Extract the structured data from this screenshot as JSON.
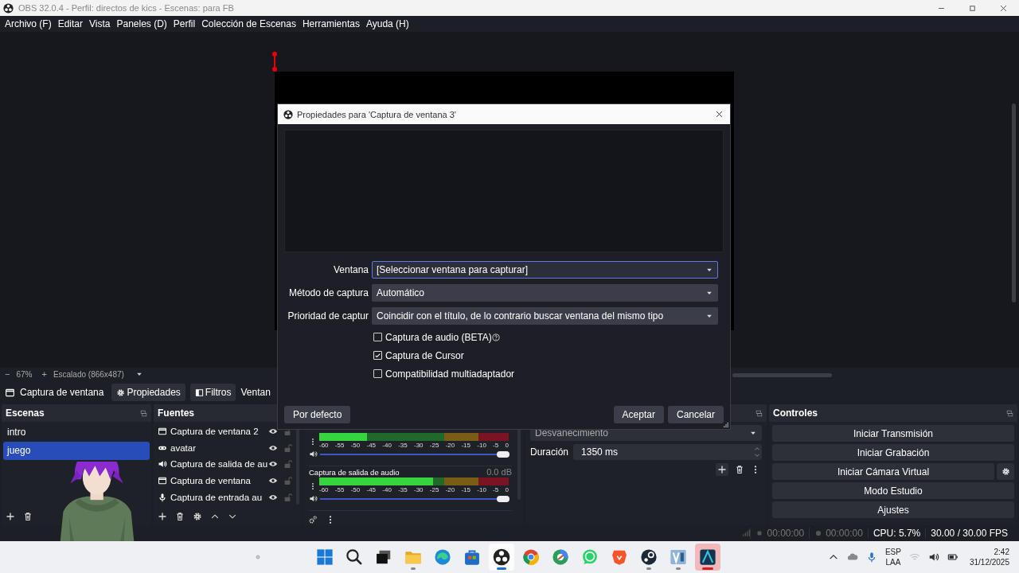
{
  "window": {
    "title": "OBS 32.0.4 - Perfil: directos de kics - Escenas: para FB"
  },
  "menu": [
    "Archivo (F)",
    "Editar",
    "Vista",
    "Paneles (D)",
    "Perfil",
    "Colección de Escenas",
    "Herramientas",
    "Ayuda (H)"
  ],
  "preview": {
    "zoom_out": "−",
    "zoom": "67%",
    "zoom_in": "+",
    "scale": "Escalado (866x487)"
  },
  "source_toolbar": {
    "source": "Captura de ventana",
    "buttons": [
      {
        "label": "Propiedades",
        "kind": "gear"
      },
      {
        "label": "Filtros",
        "kind": "filter"
      }
    ],
    "window_label": "Ventan"
  },
  "scenes": {
    "title": "Escenas",
    "items": [
      {
        "name": "intro",
        "selected": false
      },
      {
        "name": "juego",
        "selected": true
      }
    ]
  },
  "sources": {
    "title": "Fuentes",
    "items": [
      {
        "name": "Captura de ventana 2",
        "kind": "window",
        "visible": true,
        "locked": false
      },
      {
        "name": "avatar",
        "kind": "gamepad",
        "visible": true,
        "locked": false
      },
      {
        "name": "Captura de salida de au",
        "kind": "speaker",
        "visible": true,
        "locked": false
      },
      {
        "name": "Captura de ventana",
        "kind": "window",
        "visible": true,
        "locked": false
      },
      {
        "name": "Captura de entrada au",
        "kind": "mic",
        "visible": true,
        "locked": false
      }
    ]
  },
  "mixer": {
    "channels": [
      {
        "meter": {
          "level": 0.25
        },
        "volume": {
          "level": 1
        },
        "ticks": [
          "-60",
          "-55",
          "-50",
          "-45",
          "-40",
          "-35",
          "-30",
          "-25",
          "-20",
          "-15",
          "-10",
          "-5",
          "0"
        ]
      },
      {
        "name": "Captura de salida de audio",
        "reading": "0.0 dB",
        "meter": {
          "level": 0.6
        },
        "volume": {
          "level": 1
        },
        "ticks": [
          "-60",
          "-55",
          "-50",
          "-45",
          "-40",
          "-35",
          "-30",
          "-25",
          "-20",
          "-15",
          "-10",
          "-5",
          "0"
        ]
      }
    ]
  },
  "transitions": {
    "type": "Desvanecimiento",
    "duration_label": "Duración",
    "duration": "1350 ms"
  },
  "controls": {
    "title": "Controles",
    "buttons": [
      {
        "label": "Iniciar Transmisión",
        "kind": "plain"
      },
      {
        "label": "Iniciar Grabación",
        "kind": "plain"
      },
      {
        "label": "Iniciar Cámara Virtual",
        "kind": "settings"
      },
      {
        "label": "Modo Estudio",
        "kind": "plain"
      },
      {
        "label": "Ajustes",
        "kind": "plain"
      }
    ]
  },
  "status_bar": {
    "stream_time": "00:00:00",
    "record_time": "00:00:00",
    "cpu": "CPU: 5.7%",
    "fps": "30.00 / 30.00 FPS"
  },
  "dialog": {
    "title": "Propiedades para 'Captura de ventana 3'",
    "fields": [
      {
        "label": "Ventana",
        "value": "[Seleccionar ventana para capturar]",
        "focused": true
      },
      {
        "label": "Método de captura",
        "value": "Automático",
        "focused": false
      },
      {
        "label": "Prioridad de captur",
        "value": "Coincidir con el título, de lo contrario buscar ventana del mismo tipo",
        "focused": false
      }
    ],
    "checks": [
      {
        "label": "Captura de audio (BETA)",
        "checked": false,
        "help": true
      },
      {
        "label": "Captura de Cursor",
        "checked": true,
        "help": false
      },
      {
        "label": "Compatibilidad multiadaptador",
        "checked": false,
        "help": false
      }
    ],
    "defaults": "Por defecto",
    "ok": "Aceptar",
    "cancel": "Cancelar"
  },
  "taskbar": {
    "apps": [
      {
        "kind": "start",
        "running": false,
        "active": false,
        "attention": false
      },
      {
        "kind": "search",
        "running": false,
        "active": false,
        "attention": false
      },
      {
        "kind": "taskview",
        "running": false,
        "active": false,
        "attention": false
      },
      {
        "kind": "folder",
        "running": true,
        "active": false,
        "attention": false
      },
      {
        "kind": "edge",
        "running": false,
        "active": false,
        "attention": false
      },
      {
        "kind": "store",
        "running": false,
        "active": false,
        "attention": false
      },
      {
        "kind": "obs",
        "running": true,
        "active": true,
        "attention": false
      },
      {
        "kind": "chrome",
        "running": false,
        "active": false,
        "attention": false
      },
      {
        "kind": "chrome2",
        "running": false,
        "active": false,
        "attention": false
      },
      {
        "kind": "whatsapp",
        "running": false,
        "active": false,
        "attention": false
      },
      {
        "kind": "brave",
        "running": false,
        "active": false,
        "attention": false
      },
      {
        "kind": "steam",
        "running": true,
        "active": false,
        "attention": false
      },
      {
        "kind": "vs",
        "running": true,
        "active": false,
        "attention": false
      },
      {
        "kind": "tool",
        "running": true,
        "active": false,
        "attention": true
      }
    ],
    "tray": {
      "language": "ESP",
      "layout": "LAA",
      "time": "2:42",
      "date": "31/12/2025"
    }
  }
}
